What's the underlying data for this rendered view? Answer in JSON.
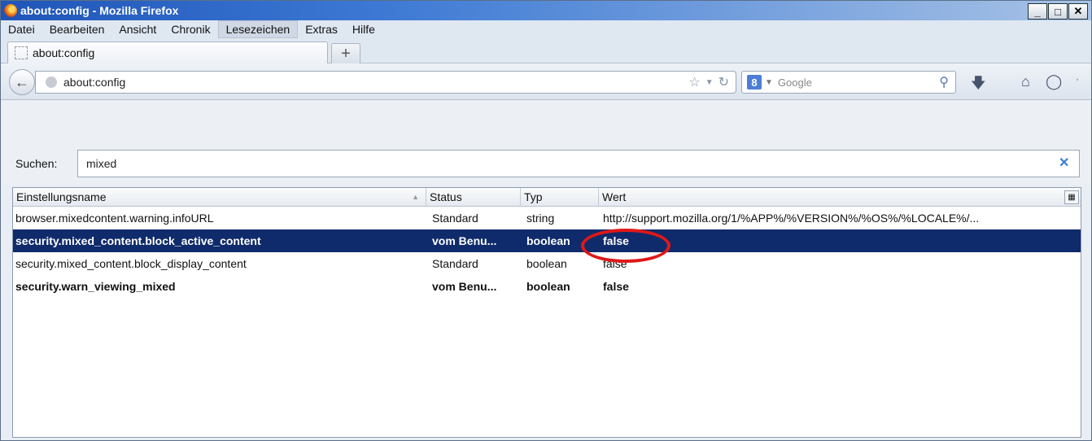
{
  "window": {
    "title": "about:config - Mozilla Firefox"
  },
  "menu": [
    "Datei",
    "Bearbeiten",
    "Ansicht",
    "Chronik",
    "Lesezeichen",
    "Extras",
    "Hilfe"
  ],
  "tab": {
    "label": "about:config",
    "new_tab_symbol": "+"
  },
  "nav": {
    "url": "about:config",
    "search_engine": "8",
    "search_placeholder": "Google",
    "icons": [
      "back-arrow-icon",
      "globe-icon",
      "star-icon",
      "dropdown-icon",
      "reload-icon",
      "google-icon",
      "magnifier-icon",
      "download-icon",
      "home-icon",
      "sync-icon"
    ]
  },
  "filter": {
    "label": "Suchen:",
    "value": "mixed"
  },
  "table": {
    "columns": [
      "Einstellungsname",
      "Status",
      "Typ",
      "Wert"
    ],
    "rows": [
      {
        "name": "browser.mixedcontent.warning.infoURL",
        "status": "Standard",
        "type": "string",
        "value": "http://support.mozilla.org/1/%APP%/%VERSION%/%OS%/%LOCALE%/...",
        "bold": false,
        "selected": false
      },
      {
        "name": "security.mixed_content.block_active_content",
        "status": "vom Benu...",
        "type": "boolean",
        "value": "false",
        "bold": true,
        "selected": true
      },
      {
        "name": "security.mixed_content.block_display_content",
        "status": "Standard",
        "type": "boolean",
        "value": "false",
        "bold": false,
        "selected": false
      },
      {
        "name": "security.warn_viewing_mixed",
        "status": "vom Benu...",
        "type": "boolean",
        "value": "false",
        "bold": true,
        "selected": false
      }
    ]
  },
  "colors": {
    "selection": "#0f2b6b",
    "annotation": "#e01818",
    "titlebar": "#1f55b8"
  }
}
